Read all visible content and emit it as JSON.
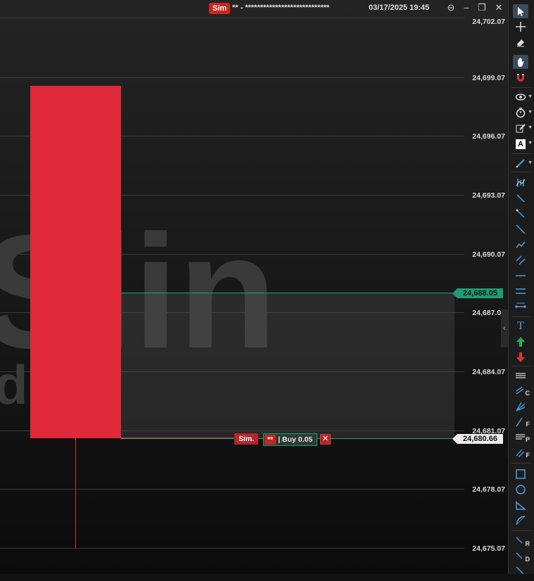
{
  "header": {
    "sim_badge": "Sim",
    "instrument": "** - ****************************",
    "datetime": "03/17/2025 19:45",
    "buttons": {
      "options": "⊖",
      "minimize": "–",
      "maximize": "❐",
      "close": "✕"
    }
  },
  "price_axis": {
    "ticks": [
      "24,702.07",
      "24,699.07",
      "24,696.07",
      "24,693.07",
      "24,690.07",
      "24,687.07",
      "24,684.07",
      "24,681.07",
      "24,678.07",
      "24,675.07"
    ]
  },
  "watermark": {
    "big": "Slin",
    "small": "de"
  },
  "price_markers": {
    "take_profit": "24,688.05",
    "entry": "24,680.66"
  },
  "order": {
    "account": "Sim.",
    "qty_badge": "**",
    "label": "| Buy 0.05",
    "close": "✕"
  },
  "colors": {
    "bearish_candle": "#e02a3a",
    "take_profit": "#1f9c74",
    "accent": "#4a9fe0"
  },
  "toolbar": {
    "tools": [
      "select-pointer-icon",
      "crosshair-icon",
      "eraser-icon",
      "hand-pan-icon",
      "magnet-icon",
      "eye-icon",
      "timer-icon",
      "edit-icon",
      "text-box-icon",
      "brush-icon",
      "indicator-icon",
      "line-icon",
      "ray-icon",
      "trend-line-icon",
      "polyline-icon",
      "channel-icon",
      "horizontal-line-icon",
      "parallel-lines-icon",
      "range-icon",
      "text-icon",
      "arrow-up-icon",
      "arrow-down-icon",
      "pitchfork-icon",
      "fib-channel-icon",
      "fib-fan-icon",
      "fib-extension-icon",
      "fib-retracement-icon",
      "fib-time-icon",
      "rectangle-icon",
      "ellipse-icon",
      "triangle-icon",
      "arc-icon",
      "regression-icon",
      "diagonal-icon",
      "angle-icon"
    ],
    "suffix_c": "C",
    "suffix_f": "F",
    "suffix_p": "P",
    "suffix_f2": "F",
    "suffix_r": "R",
    "suffix_d": "D",
    "text_tool": "A",
    "text_t": "T"
  }
}
